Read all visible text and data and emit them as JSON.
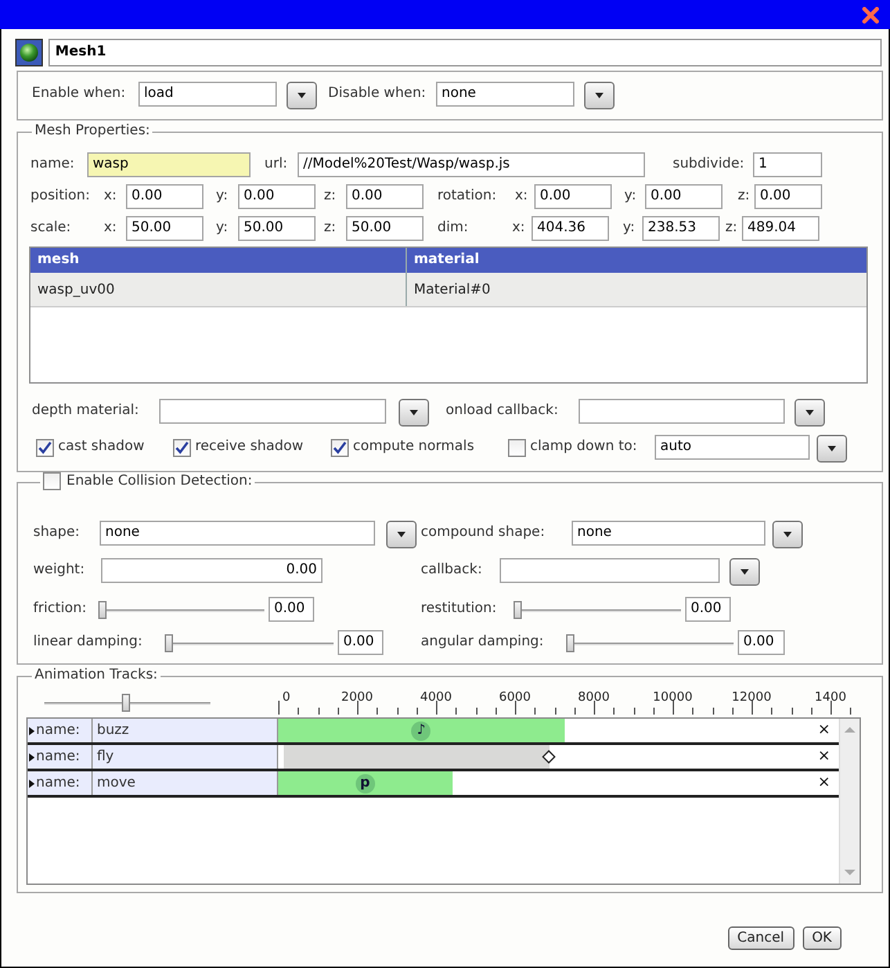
{
  "object_name": "Mesh1",
  "activation": [
    {
      "kind": "select",
      "label": "Enable when:",
      "value": "load"
    },
    {
      "kind": "select",
      "label": "Disable when:",
      "value": "none"
    }
  ],
  "mesh_properties": {
    "legend": "Mesh Properties:",
    "identity": [
      {
        "kind": "field",
        "label": "name:",
        "value": "wasp",
        "highlighted": true
      },
      {
        "kind": "field",
        "label": "url:",
        "value": "//Model%20Test/Wasp/wasp.js",
        "highlighted": false
      },
      {
        "kind": "field",
        "label": "subdivide:",
        "value": "1",
        "highlighted": false
      }
    ],
    "transforms": [
      [
        {
          "kind": "text",
          "text": "position:"
        },
        {
          "kind": "field",
          "label": "x:",
          "value": "0.00"
        },
        {
          "kind": "field",
          "label": "y:",
          "value": "0.00"
        },
        {
          "kind": "field",
          "label": "z:",
          "value": "0.00"
        },
        {
          "kind": "text",
          "text": "rotation:"
        },
        {
          "kind": "field",
          "label": "x:",
          "value": "0.00"
        },
        {
          "kind": "field",
          "label": "y:",
          "value": "0.00"
        },
        {
          "kind": "field",
          "label": "z:",
          "value": "0.00"
        }
      ],
      [
        {
          "kind": "text",
          "text": "scale:"
        },
        {
          "kind": "field",
          "label": "x:",
          "value": "50.00"
        },
        {
          "kind": "field",
          "label": "y:",
          "value": "50.00"
        },
        {
          "kind": "field",
          "label": "z:",
          "value": "50.00"
        },
        {
          "kind": "text",
          "text": "dim:"
        },
        {
          "kind": "field",
          "label": "x:",
          "value": "404.36"
        },
        {
          "kind": "field",
          "label": "y:",
          "value": "238.53"
        },
        {
          "kind": "field",
          "label": "z:",
          "value": "489.04"
        }
      ]
    ],
    "table": {
      "columns": [
        "mesh",
        "material"
      ],
      "rows": [
        {
          "cells": [
            "wasp_uv00",
            "Material#0"
          ],
          "selected": true
        }
      ]
    },
    "options": [
      [
        {
          "kind": "select",
          "label": "depth material:"
        },
        {
          "kind": "select",
          "label": "onload callback:"
        }
      ],
      [
        {
          "kind": "check",
          "label": "cast shadow",
          "checked": true
        },
        {
          "kind": "check",
          "label": "receive shadow",
          "checked": true
        },
        {
          "kind": "check",
          "label": "compute normals",
          "checked": true
        },
        {
          "kind": "check",
          "label": "clamp down to:",
          "checked": false
        },
        {
          "kind": "select",
          "value": "auto"
        }
      ]
    ]
  },
  "collision": {
    "legend": "Enable Collision Detection:",
    "checked": false,
    "rows": [
      [
        {
          "kind": "select",
          "label": "shape:",
          "value": "none"
        },
        {
          "kind": "select",
          "label": "compound shape:",
          "value": "none"
        }
      ],
      [
        {
          "kind": "field",
          "label": "weight:",
          "value": "0.00"
        },
        {
          "kind": "select",
          "label": "callback:"
        }
      ],
      [
        {
          "kind": "slider",
          "label": "friction:",
          "level": 0,
          "value": "0.00"
        },
        {
          "kind": "slider",
          "label": "restitution:",
          "level": 0,
          "value": "0.00"
        }
      ],
      [
        {
          "kind": "slider",
          "label": "linear damping:",
          "level": 0,
          "value": "0.00"
        },
        {
          "kind": "slider",
          "label": "angular damping:",
          "level": 0,
          "value": "0.00"
        }
      ]
    ]
  },
  "animation_tracks": {
    "legend": "Animation Tracks:",
    "zoom": {
      "level": 0.5
    },
    "ruler_labels": [
      "0",
      "2000",
      "4000",
      "6000",
      "8000",
      "10000",
      "12000",
      "1400"
    ],
    "tracks": [
      {
        "label": "name:",
        "name": "buzz",
        "expanded": false,
        "kind": "sound",
        "level": 0.51,
        "marker": "♪",
        "remove": "×"
      },
      {
        "label": "name:",
        "name": "fly",
        "expanded": false,
        "kind": "keyframes",
        "level": 0.485,
        "remove": "×"
      },
      {
        "label": "name:",
        "name": "move",
        "expanded": false,
        "kind": "path",
        "level": 0.31,
        "marker": "p",
        "remove": "×"
      }
    ]
  },
  "buttons": [
    "Cancel",
    "OK"
  ]
}
